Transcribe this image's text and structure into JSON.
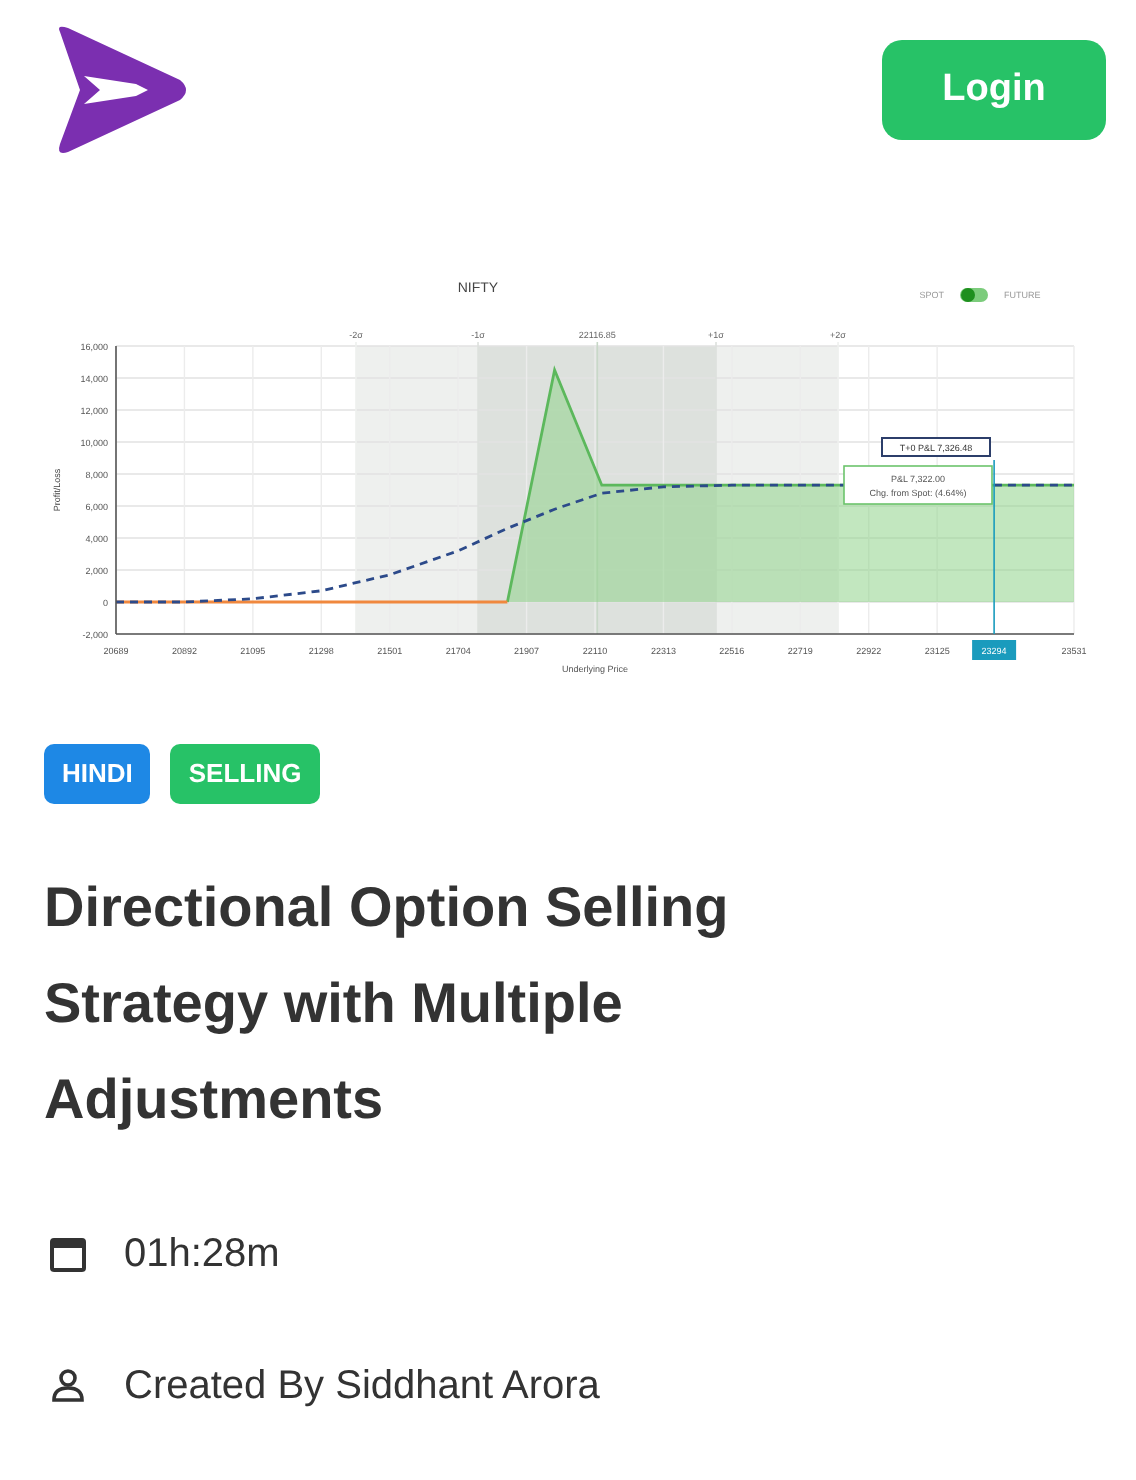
{
  "header": {
    "login": "Login"
  },
  "chart": {
    "toggle": {
      "left": "SPOT",
      "right": "FUTURE",
      "on": true
    },
    "tooltips": [
      "T+0 P&L 7,326.48",
      "P&L 7,322.00",
      "Chg. from Spot: (4.64%)"
    ],
    "chart_data": {
      "type": "line",
      "title": "NIFTY",
      "xlabel": "Underlying Price",
      "ylabel": "Profit/Loss",
      "grid": true,
      "x": [
        20689,
        20892,
        21095,
        21298,
        21501,
        21704,
        21850,
        21990,
        22130,
        22313,
        22516,
        23531
      ],
      "series": [
        {
          "color": "#5cb85c",
          "line_style": "solid",
          "values": [
            null,
            null,
            null,
            null,
            null,
            null,
            0,
            14500,
            7300,
            7300,
            7300,
            7300
          ]
        },
        {
          "color": "#f0883e",
          "line_style": "solid",
          "values": [
            0,
            0,
            0,
            0,
            0,
            0,
            0,
            null,
            null,
            null,
            null,
            null
          ]
        },
        {
          "color": "#2c4a8a",
          "line_style": "dashed",
          "values": [
            0,
            0,
            200,
            700,
            1700,
            3200,
            4600,
            5800,
            6800,
            7200,
            7300,
            7300
          ]
        }
      ],
      "xlim": [
        20689,
        23531
      ],
      "ylim": [
        -2000,
        16000
      ],
      "xticks": [
        20689,
        20892,
        21095,
        21298,
        21501,
        21704,
        21907,
        22110,
        22313,
        22516,
        22719,
        22922,
        23125,
        23531
      ],
      "yticks": [
        {
          "value": -2000,
          "label": "-2,000"
        },
        {
          "value": 0,
          "label": "0"
        },
        {
          "value": 2000,
          "label": "2,000"
        },
        {
          "value": 4000,
          "label": "4,000"
        },
        {
          "value": 6000,
          "label": "6,000"
        },
        {
          "value": 8000,
          "label": "8,000"
        },
        {
          "value": 10000,
          "label": "10,000"
        },
        {
          "value": 12000,
          "label": "12,000"
        },
        {
          "value": 14000,
          "label": "14,000"
        },
        {
          "value": 16000,
          "label": "16,000"
        }
      ],
      "bands": [
        {
          "axis": "x",
          "from": 21401,
          "to": 22831,
          "color": "#eef0ee"
        },
        {
          "axis": "x",
          "from": 21763,
          "to": 22469,
          "color": "#dde1dd"
        }
      ],
      "ref_lines": [
        {
          "axis": "x",
          "value": 21401,
          "color": "#eef0ee",
          "label": "-2σ"
        },
        {
          "axis": "x",
          "value": 21763,
          "color": "#dde1dd",
          "label": "-1σ"
        },
        {
          "axis": "x",
          "value": 22116.85,
          "color": "#c8d8c8",
          "label": "22116.85"
        },
        {
          "axis": "x",
          "value": 22469,
          "color": "#dde1dd",
          "label": "+1σ"
        },
        {
          "axis": "x",
          "value": 22831,
          "color": "#eef0ee",
          "label": "+2σ"
        },
        {
          "axis": "x",
          "value": 23294,
          "color": "#1a9bbd",
          "label": "23294"
        }
      ]
    }
  },
  "tags": [
    {
      "label": "HINDI",
      "color": "#1e88e5"
    },
    {
      "label": "SELLING",
      "color": "#27c267"
    }
  ],
  "title": "Directional Option Selling Strategy with Multiple Adjustments",
  "duration": "01h:28m",
  "author": "Created By Siddhant Arora"
}
